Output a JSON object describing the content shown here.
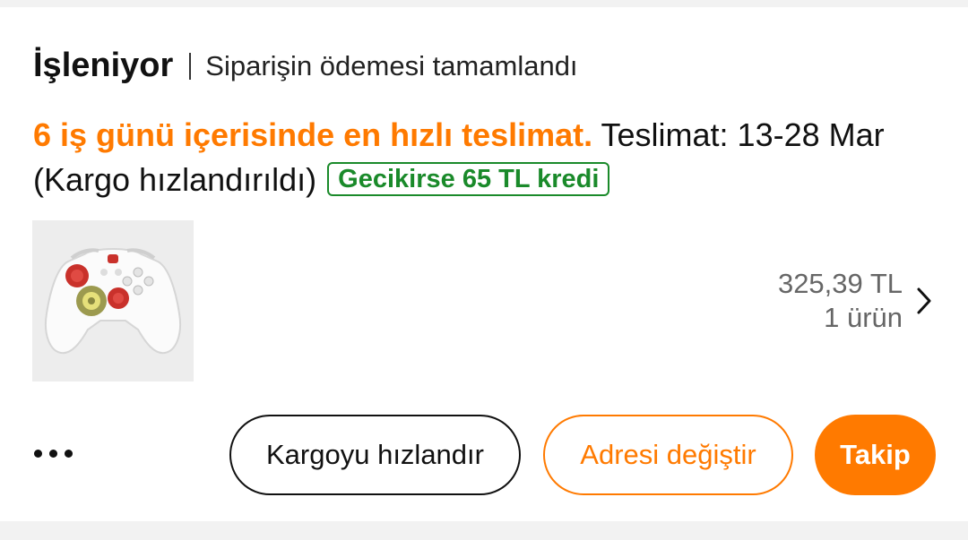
{
  "order": {
    "status_title": "İşleniyor",
    "status_subtitle": "Siparişin ödemesi tamamlandı"
  },
  "delivery": {
    "fast_text": "6 iş günü içerisinde en hızlı teslimat.",
    "details_text": " Teslimat: 13-28 Mar (Kargo hızlandırıldı)",
    "credit_badge": "Gecikirse 65 TL kredi"
  },
  "product": {
    "image_icon": "game-controller-icon",
    "price": "325,39 TL",
    "quantity": "1 ürün"
  },
  "actions": {
    "more_icon": "more-dots-icon",
    "speed_up_label": "Kargoyu hızlandır",
    "change_address_label": "Adresi değiştir",
    "track_label": "Takip"
  },
  "colors": {
    "accent": "#ff7a00",
    "credit_green": "#1a8a2a",
    "background": "#f2f2f2",
    "card": "#ffffff"
  }
}
